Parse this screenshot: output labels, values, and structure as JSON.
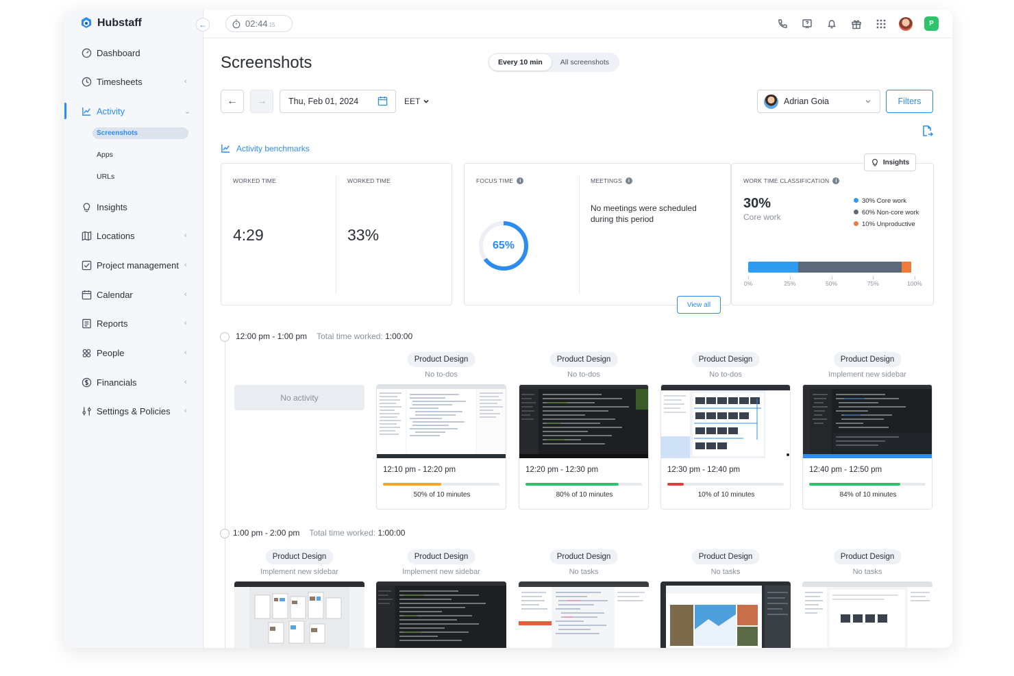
{
  "app": {
    "name": "Hubstaff"
  },
  "sidebar": {
    "items": [
      {
        "label": "Dashboard",
        "icon": "dashboard-icon",
        "chevron": ""
      },
      {
        "label": "Timesheets",
        "icon": "clock-icon",
        "chevron": "‹"
      },
      {
        "label": "Activity",
        "icon": "activity-chart-icon",
        "chevron": "⌄"
      },
      {
        "label": "Insights",
        "icon": "lightbulb-icon",
        "chevron": ""
      },
      {
        "label": "Locations",
        "icon": "map-icon",
        "chevron": "‹"
      },
      {
        "label": "Project management",
        "icon": "checkbox-icon",
        "chevron": "‹"
      },
      {
        "label": "Calendar",
        "icon": "calendar-icon",
        "chevron": "‹"
      },
      {
        "label": "Reports",
        "icon": "report-icon",
        "chevron": "‹"
      },
      {
        "label": "People",
        "icon": "people-icon",
        "chevron": "‹"
      },
      {
        "label": "Financials",
        "icon": "dollar-icon",
        "chevron": "‹"
      },
      {
        "label": "Settings & Policies",
        "icon": "sliders-icon",
        "chevron": "‹"
      }
    ],
    "activity_sub": [
      "Screenshots",
      "Apps",
      "URLs"
    ]
  },
  "topbar": {
    "timer": "02:44",
    "timer_seconds": "15",
    "org_initial": "P"
  },
  "page": {
    "title": "Screenshots",
    "toggle": [
      "Every 10 min",
      "All screenshots"
    ],
    "date": "Thu, Feb 01, 2024",
    "timezone": "EET",
    "user": "Adrian Goia",
    "filters": "Filters",
    "benchmarks_link": "Activity benchmarks"
  },
  "cards": {
    "worked_time_label": "WORKED TIME",
    "worked_time_value": "4:29",
    "activity_label": "WORKED TIME",
    "activity_value": "33%",
    "focus_label": "FOCUS TIME",
    "focus_value": "65%",
    "focus_fraction": 0.65,
    "meetings_label": "MEETINGS",
    "meetings_text": "No meetings were scheduled during this period",
    "view_all": "View all",
    "insights_btn": "Insights",
    "wtc_label": "WORK TIME CLASSIFICATION",
    "wtc_big": "30%",
    "wtc_sub": "Core work",
    "legend": [
      {
        "text": "30% Core work",
        "color": "#2d9cf0",
        "share": 30
      },
      {
        "text": "60% Non-core work",
        "color": "#5d6878",
        "share": 62
      },
      {
        "text": "10% Unproductive",
        "color": "#f07a3a",
        "share": 6
      }
    ],
    "ticks": [
      "0%",
      "25%",
      "50%",
      "75%",
      "100%"
    ]
  },
  "slots": [
    {
      "range": "12:00  pm - 1:00 pm",
      "total_label": "Total time worked:",
      "total_value": "1:00:00",
      "no_activity": "No activity"
    },
    {
      "range": "1:00  pm - 2:00 pm",
      "total_label": "Total time worked:",
      "total_value": "1:00:00"
    }
  ],
  "row1": [
    {
      "project": "Product Design",
      "task": "No to-dos",
      "range": "12:10 pm - 12:20 pm",
      "pct": "50% of 10 minutes",
      "fraction": 0.5,
      "color": "#f5a623"
    },
    {
      "project": "Product Design",
      "task": "No to-dos",
      "range": "12:20 pm - 12:30 pm",
      "pct": "80% of 10 minutes",
      "fraction": 0.8,
      "color": "#2fc46b"
    },
    {
      "project": "Product Design",
      "task": "No to-dos",
      "range": "12:30 pm - 12:40 pm",
      "pct": "10% of 10 minutes",
      "fraction": 0.14,
      "color": "#e8393a"
    },
    {
      "project": "Product Design",
      "task": "Implement new sidebar",
      "range": "12:40 pm - 12:50 pm",
      "pct": "84% of 10 minutes",
      "fraction": 0.78,
      "color": "#2fc46b"
    }
  ],
  "row2": [
    {
      "project": "Product Design",
      "task": "Implement new sidebar"
    },
    {
      "project": "Product Design",
      "task": "Implement new sidebar"
    },
    {
      "project": "Product Design",
      "task": "No tasks"
    },
    {
      "project": "Product Design",
      "task": "No tasks"
    },
    {
      "project": "Product Design",
      "task": "No tasks"
    }
  ]
}
